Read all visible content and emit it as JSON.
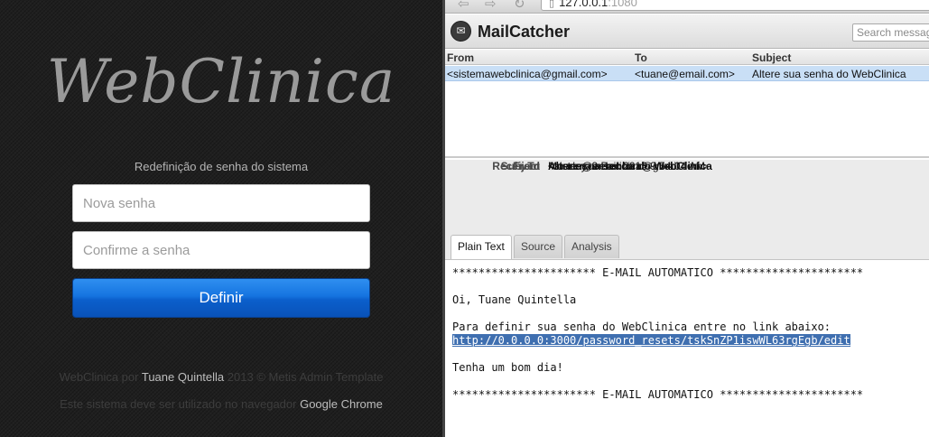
{
  "left": {
    "brand": "WebClinica",
    "subtitle": "Redefinição de senha do sistema",
    "password_placeholder": "Nova senha",
    "confirm_placeholder": "Confirme a senha",
    "submit_label": "Definir",
    "footer1": {
      "pre": "WebClinica por ",
      "author": "Tuane Quintella",
      "post": "  2013 © Metis Admin Template"
    },
    "footer2": {
      "pre": "Este sistema deve ser utilizado no navegador ",
      "browser": "Google Chrome"
    }
  },
  "browser": {
    "url_host": "127.0.0.1",
    "url_port": ":1080",
    "icons": [
      "back-arrow-icon",
      "forward-arrow-icon",
      "reload-icon",
      "page-icon"
    ]
  },
  "mailcatcher": {
    "title": "MailCatcher",
    "search_placeholder": "Search messages",
    "columns": {
      "from": "From",
      "to": "To",
      "subject": "Subject"
    },
    "messages": [
      {
        "from": "<sistemawebclinica@gmail.com>",
        "to": "<tuane@email.com>",
        "subject": "Altere sua senha do WebClinica"
      }
    ],
    "selected_color": "#c9dff6",
    "detail": {
      "received_label": "Received",
      "received": "Monday, 9 Dec 2013 9:54:04 AM",
      "from_label": "From",
      "from": "<sistemawebclinica@gmail.com>",
      "to_label": "To",
      "to": "<tuane@email.com>",
      "subject_label": "Subject",
      "subject": "Altere sua senha do WebClinica"
    },
    "tabs": {
      "plain": "Plain Text",
      "source": "Source",
      "analysis": "Analysis"
    },
    "body": {
      "banner": "********************** E-MAIL AUTOMATICO **********************",
      "greeting": "Oi, Tuane Quintella",
      "instruction": "Para definir sua senha do WebClinica entre no link abaixo:",
      "link": "http://0.0.0.0:3000/password_resets/tskSnZP1iswWL63rgEgb/edit",
      "closing": "Tenha um bom dia!",
      "banner_end": "********************** E-MAIL AUTOMATICO **********************"
    }
  },
  "colors": {
    "button_blue": "#1574e0",
    "page_dark": "#1f1f1f",
    "brand_grey": "#9a9a9a"
  }
}
